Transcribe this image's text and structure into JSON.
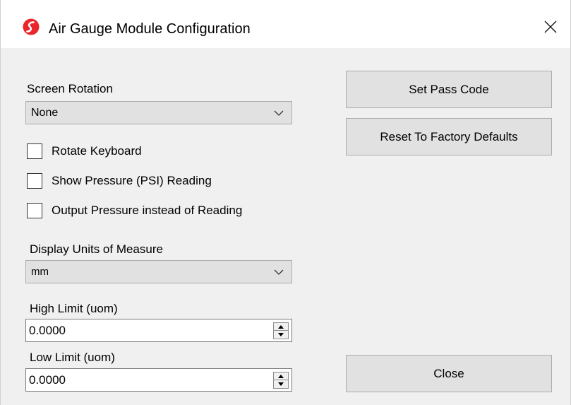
{
  "window": {
    "title": "Air Gauge Module Configuration",
    "icon": "app-logo-icon",
    "accent_color": "#e8262c"
  },
  "screen_rotation": {
    "label": "Screen Rotation",
    "selected": "None"
  },
  "checkboxes": [
    {
      "label": "Rotate Keyboard",
      "checked": false
    },
    {
      "label": "Show Pressure (PSI) Reading",
      "checked": false
    },
    {
      "label": "Output Pressure instead of Reading",
      "checked": false
    }
  ],
  "display_units": {
    "label": "Display Units of Measure",
    "selected": "mm"
  },
  "high_limit": {
    "label": "High Limit (uom)",
    "value": "0.0000"
  },
  "low_limit": {
    "label": "Low Limit (uom)",
    "value": "0.0000"
  },
  "buttons": {
    "set_pass_code": "Set Pass Code",
    "reset_defaults": "Reset To Factory Defaults",
    "close": "Close"
  }
}
